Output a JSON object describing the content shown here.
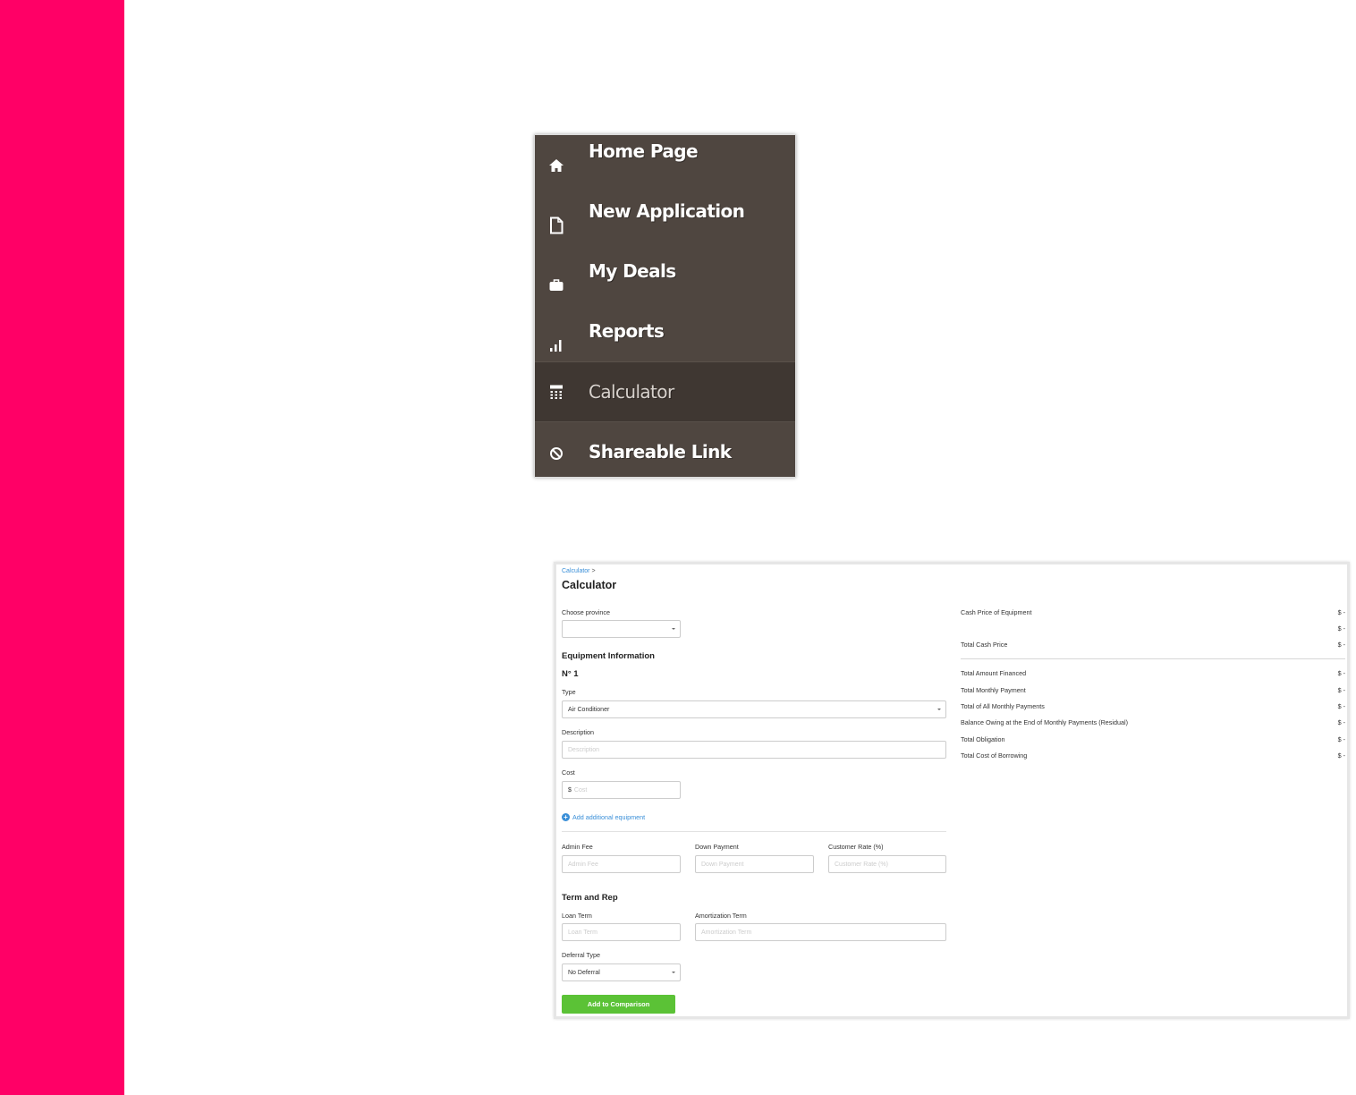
{
  "nav": {
    "items": [
      {
        "label": "Home Page",
        "icon": "home-icon"
      },
      {
        "label": "New Application",
        "icon": "file-icon"
      },
      {
        "label": "My Deals",
        "icon": "briefcase-icon"
      },
      {
        "label": "Reports",
        "icon": "bar-chart-icon"
      },
      {
        "label": "Calculator",
        "icon": "calculator-icon",
        "active": true
      },
      {
        "label": "Shareable Link",
        "icon": "link-icon"
      }
    ]
  },
  "calculator": {
    "breadcrumb": "Calculator",
    "breadcrumb_sep": ">",
    "title": "Calculator",
    "province_label": "Choose province",
    "province_value": "",
    "equipment_heading": "Equipment Information",
    "equipment_number": "N° 1",
    "type_label": "Type",
    "type_value": "Air Conditioner",
    "description_label": "Description",
    "description_placeholder": "Description",
    "cost_label": "Cost",
    "cost_currency": "$",
    "cost_placeholder": "Cost",
    "add_equipment": "Add additional equipment",
    "admin_fee_label": "Admin Fee",
    "admin_fee_placeholder": "Admin Fee",
    "down_payment_label": "Down Payment",
    "down_payment_placeholder": "Down Payment",
    "customer_rate_label": "Customer Rate (%)",
    "customer_rate_placeholder": "Customer Rate (%)",
    "term_heading": "Term and Rep",
    "loan_term_label": "Loan Term",
    "loan_term_placeholder": "Loan Term",
    "amortization_label": "Amortization Term",
    "amortization_placeholder": "Amortization Term",
    "deferral_label": "Deferral Type",
    "deferral_value": "No Deferral",
    "add_to_comparison": "Add to Comparison"
  },
  "summary": {
    "cash_price_label": "Cash Price of Equipment",
    "cash_price_value": "$ -",
    "blank_value": "$ -",
    "total_cash_label": "Total Cash Price",
    "total_cash_value": "$ -",
    "rows": [
      {
        "label": "Total Amount Financed",
        "value": "$ -"
      },
      {
        "label": "Total Monthly Payment",
        "value": "$ -"
      },
      {
        "label": "Total of All Monthly Payments",
        "value": "$ -"
      },
      {
        "label": "Balance Owing at the End of Monthly Payments (Residual)",
        "value": "$ -"
      },
      {
        "label": "Total Obligation",
        "value": "$ -"
      },
      {
        "label": "Total Cost of Borrowing",
        "value": "$ -"
      }
    ]
  },
  "colors": {
    "accent": "#ff0066",
    "nav_bg": "#4f4640",
    "nav_active_bg": "#3f3732",
    "link": "#3a8fd8",
    "button": "#5bc236"
  }
}
